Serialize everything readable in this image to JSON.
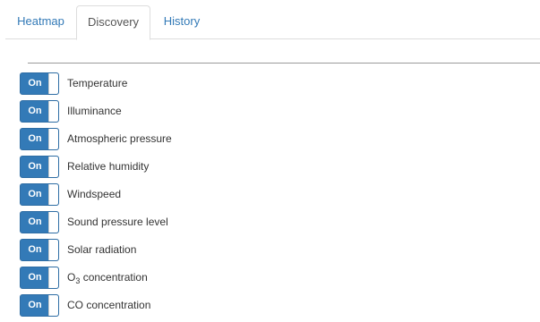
{
  "tabs": [
    {
      "label": "Heatmap",
      "active": false
    },
    {
      "label": "Discovery",
      "active": true
    },
    {
      "label": "History",
      "active": false
    }
  ],
  "toggle_label": "On",
  "sensors": [
    {
      "label": "Temperature",
      "state": "On"
    },
    {
      "label": "Illuminance",
      "state": "On"
    },
    {
      "label": "Atmospheric pressure",
      "state": "On"
    },
    {
      "label": "Relative humidity",
      "state": "On"
    },
    {
      "label": "Windspeed",
      "state": "On"
    },
    {
      "label": "Sound pressure level",
      "state": "On"
    },
    {
      "label": "Solar radiation",
      "state": "On"
    },
    {
      "label_prefix": "O",
      "label_subscript": "3",
      "label_suffix": " concentration",
      "state": "On"
    },
    {
      "label": "CO concentration",
      "state": "On"
    }
  ],
  "colors": {
    "toggle_on": "#337ab7",
    "tab_link": "#337ab7"
  }
}
